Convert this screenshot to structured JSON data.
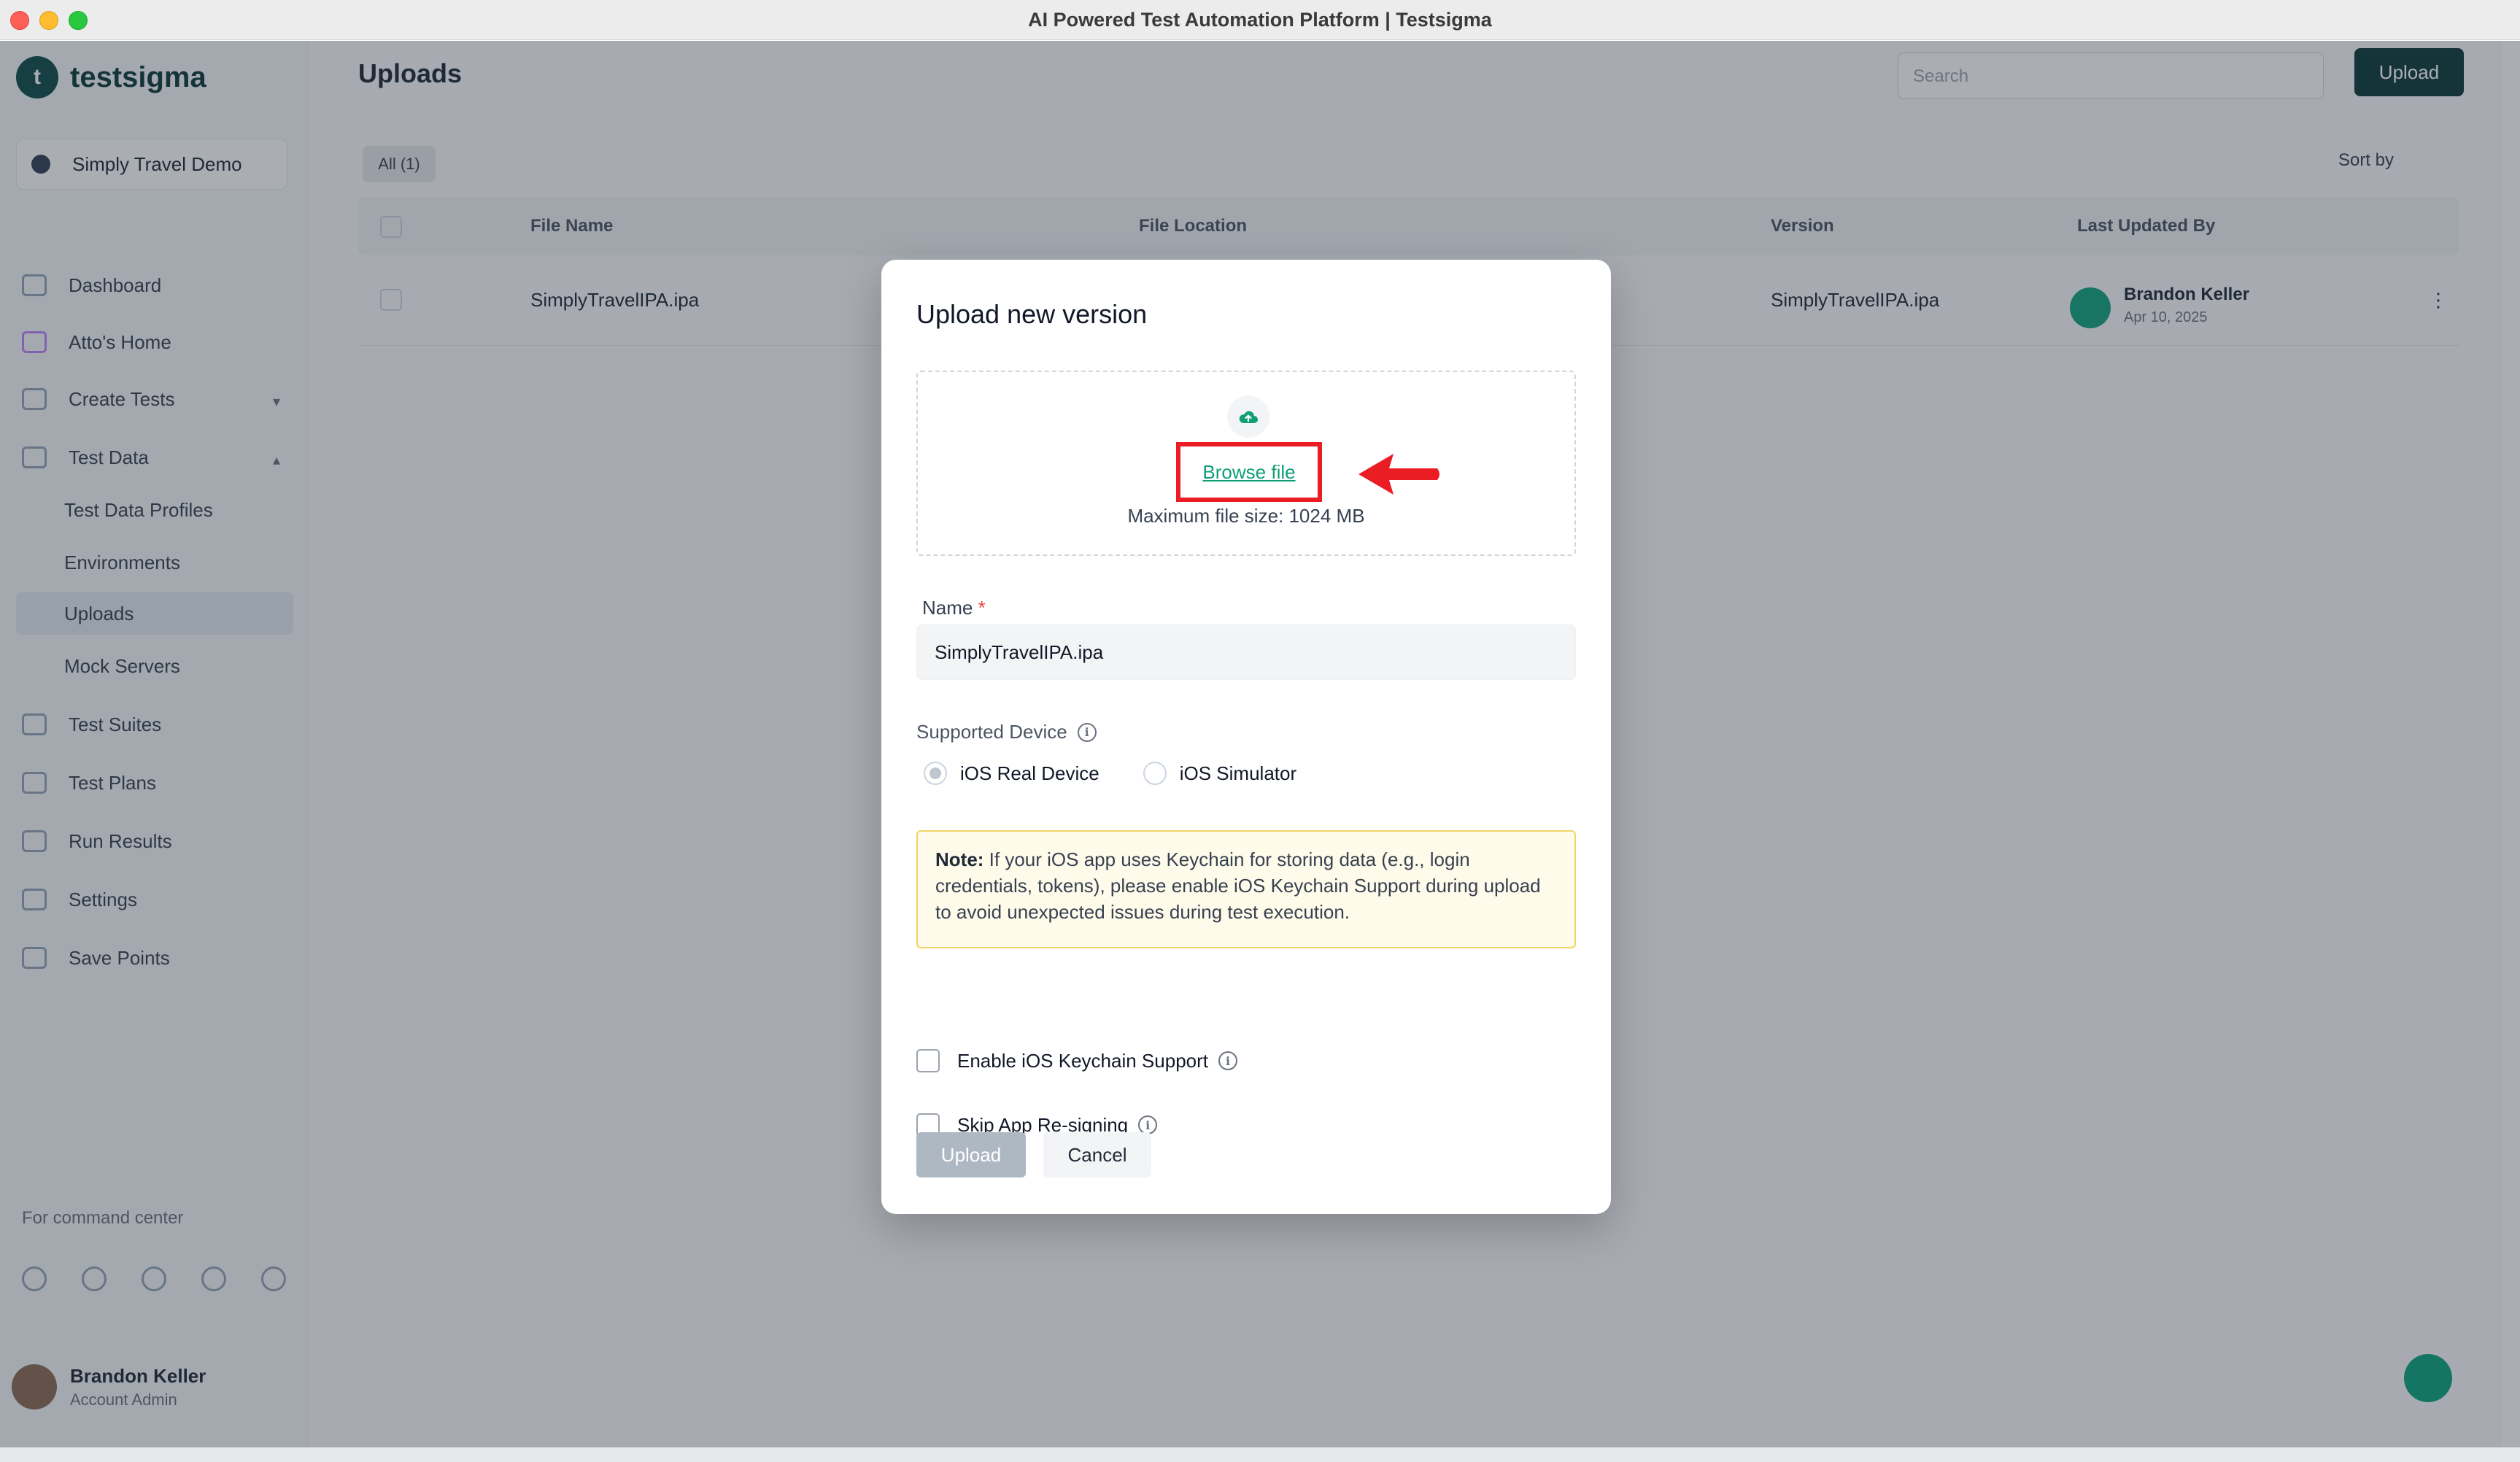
{
  "window": {
    "title": "AI Powered Test Automation Platform | Testsigma"
  },
  "sidebar": {
    "brand": "testsigma",
    "project": "Simply Travel Demo",
    "items": [
      {
        "label": "Dashboard",
        "icon": "dashboard-icon"
      },
      {
        "label": "Atto's Home",
        "icon": "home-icon"
      },
      {
        "label": "Create Tests",
        "icon": "create-icon"
      },
      {
        "label": "Test Data",
        "icon": "data-icon"
      },
      {
        "label": "Test Data Profiles",
        "icon": ""
      },
      {
        "label": "Environments",
        "icon": ""
      },
      {
        "label": "Uploads",
        "icon": ""
      },
      {
        "label": "Mock Servers",
        "icon": ""
      },
      {
        "label": "Test Suites",
        "icon": "suites-icon"
      },
      {
        "label": "Test Plans",
        "icon": "plans-icon"
      },
      {
        "label": "Run Results",
        "icon": "results-icon"
      },
      {
        "label": "Settings",
        "icon": "settings-icon"
      },
      {
        "label": "Save Points",
        "icon": "savepoints-icon"
      }
    ],
    "hint": "For command center",
    "user": {
      "name": "Brandon Keller",
      "role": "Account Admin"
    }
  },
  "main": {
    "page_title": "Uploads",
    "search_placeholder": "Search",
    "upload_button": "Upload",
    "filter": "All (1)",
    "sort_by": "Sort by",
    "columns": [
      "File Name",
      "File Location",
      "Version",
      "Last Updated By"
    ],
    "row": {
      "file_name": "SimplyTravelIPA.ipa",
      "version": "SimplyTravelIPA.ipa",
      "updated_by": "Brandon Keller",
      "updated_on": "Apr 10, 2025"
    }
  },
  "modal": {
    "title": "Upload new version",
    "browse_label": "Browse file",
    "max_size": "Maximum file size: 1024 MB",
    "name_label": "Name",
    "required_mark": "*",
    "name_value": "SimplyTravelIPA.ipa",
    "device_label": "Supported Device",
    "device_options": [
      "iOS Real Device",
      "iOS Simulator"
    ],
    "selected_device": "iOS Real Device",
    "note_label": "Note:",
    "note_text": " If your iOS app uses Keychain for storing data (e.g., login credentials, tokens), please enable iOS Keychain Support during upload to avoid unexpected issues during test execution.",
    "keychain_label": "Enable iOS Keychain Support",
    "keychain_checked": false,
    "resign_label": "Skip App Re-signing",
    "resign_checked": false,
    "upload_label": "Upload",
    "cancel_label": "Cancel"
  },
  "colors": {
    "accent_green": "#0f9f76",
    "annotation_red": "#ea1c24",
    "note_border": "#f2d466",
    "note_bg": "#fffbea"
  }
}
